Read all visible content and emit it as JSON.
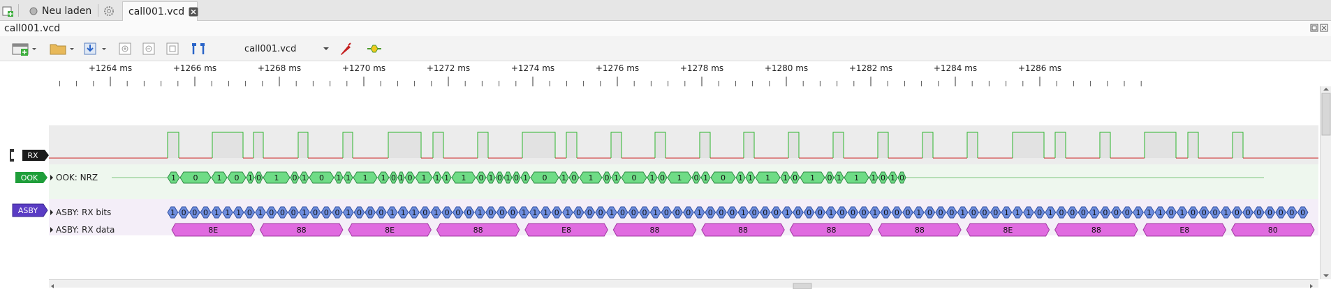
{
  "tabs": [
    {
      "label": "",
      "icon": "add-session-icon"
    },
    {
      "label": "Neu laden",
      "icon": "reload-icon"
    },
    {
      "label": "",
      "icon": "settings-gear-icon"
    },
    {
      "label": "call001.vcd",
      "icon": "close-icon",
      "active": true
    }
  ],
  "view": {
    "title": "call001.vcd",
    "device_combo": "call001.vcd"
  },
  "toolbar": {
    "items": [
      "add-view-icon",
      "open-file-icon",
      "save-download-icon",
      "zoom-in-icon",
      "zoom-out-icon",
      "zoom-fit-icon",
      "show-cursors-icon",
      "probe-icon",
      "decoder-icon"
    ]
  },
  "ruler": {
    "ticks": [
      {
        "ms": 1264,
        "label": "+1264 ms"
      },
      {
        "ms": 1266,
        "label": "+1266 ms"
      },
      {
        "ms": 1268,
        "label": "+1268 ms"
      },
      {
        "ms": 1270,
        "label": "+1270 ms"
      },
      {
        "ms": 1272,
        "label": "+1272 ms"
      },
      {
        "ms": 1274,
        "label": "+1274 ms"
      },
      {
        "ms": 1276,
        "label": "+1276 ms"
      },
      {
        "ms": 1278,
        "label": "+1278 ms"
      },
      {
        "ms": 1280,
        "label": "+1280 ms"
      },
      {
        "ms": 1282,
        "label": "+1282 ms"
      },
      {
        "ms": 1284,
        "label": "+1284 ms"
      },
      {
        "ms": 1286,
        "label": "+1286 ms"
      }
    ],
    "minor_per_major": 5
  },
  "rows": {
    "rx": {
      "badge": "RX",
      "color": "#1b1b1b",
      "high": "#2db52d",
      "low": "#cc2222"
    },
    "ook": {
      "badge": "OOK",
      "label": "OOK: NRZ",
      "color": "#1f9e3a"
    },
    "asby_bits": {
      "badge": "ASBY",
      "label": "ASBY: RX bits",
      "color": "#5a3cc4"
    },
    "asby_data": {
      "label": "ASBY: RX data",
      "color": "#e06be0"
    }
  },
  "ook_segments": [
    "1",
    "0",
    "1",
    "0",
    "1",
    "0",
    "1",
    "0",
    "1",
    "0",
    "1",
    "1",
    "1",
    "1",
    "0",
    "1",
    "0",
    "1",
    "1",
    "1",
    "1",
    "0",
    "1",
    "0",
    "1",
    "0",
    "1",
    "0",
    "1",
    "0",
    "1",
    "0",
    "1",
    "0",
    "1",
    "0",
    "1",
    "0",
    "1",
    "0",
    "1",
    "1",
    "1",
    "1",
    "0",
    "1",
    "0",
    "1",
    "1",
    "1",
    "0",
    "1",
    "0"
  ],
  "asby_bits": [
    "1",
    "0",
    "0",
    "0",
    "1",
    "1",
    "1",
    "0",
    "1",
    "0",
    "0",
    "0",
    "1",
    "0",
    "0",
    "0",
    "1",
    "0",
    "0",
    "0",
    "1",
    "1",
    "1",
    "0",
    "1",
    "0",
    "0",
    "0",
    "1",
    "0",
    "0",
    "0",
    "1",
    "1",
    "1",
    "0",
    "1",
    "0",
    "0",
    "0",
    "1",
    "0",
    "0",
    "0",
    "1",
    "0",
    "0",
    "0",
    "1",
    "0",
    "0",
    "0",
    "1",
    "0",
    "0",
    "0",
    "1",
    "0",
    "0",
    "0",
    "1",
    "0",
    "0",
    "0",
    "1",
    "0",
    "0",
    "0",
    "1",
    "0",
    "0",
    "0",
    "1",
    "0",
    "0",
    "0",
    "1",
    "1",
    "1",
    "0",
    "1",
    "0",
    "0",
    "0",
    "1",
    "0",
    "0",
    "0",
    "1",
    "1",
    "1",
    "0",
    "1",
    "0",
    "0",
    "0",
    "1",
    "0",
    "0",
    "0",
    "0",
    "0",
    "0",
    "0"
  ],
  "asby_bytes": [
    "8E",
    "88",
    "8E",
    "88",
    "E8",
    "88",
    "88",
    "88",
    "88",
    "8E",
    "88",
    "E8",
    "80"
  ]
}
